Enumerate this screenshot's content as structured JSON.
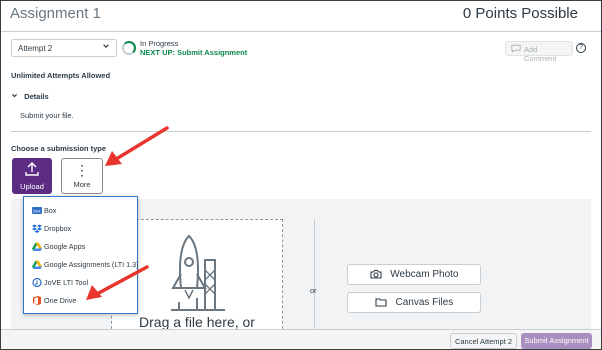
{
  "header": {
    "title": "Assignment 1",
    "points": "0 Points Possible"
  },
  "attempt": {
    "selected": "Attempt 2",
    "status": "In Progress",
    "next_up": "NEXT UP: Submit Assignment"
  },
  "comment": {
    "add_label": "Add Comment",
    "help": "?"
  },
  "info": {
    "unlimited": "Unlimited Attempts Allowed",
    "details_label": "Details",
    "details_text": "Submit your file."
  },
  "submission": {
    "choose_label": "Choose a submission type",
    "upload_label": "Upload",
    "more_label": "More",
    "menu": [
      {
        "label": "Box",
        "icon": "box-icon"
      },
      {
        "label": "Dropbox",
        "icon": "dropbox-icon"
      },
      {
        "label": "Google Apps",
        "icon": "google-drive-icon"
      },
      {
        "label": "Google Assignments (LTI 1.3)",
        "icon": "google-drive-icon"
      },
      {
        "label": "JoVE LTI Tool",
        "icon": "jove-icon"
      },
      {
        "label": "One Drive",
        "icon": "office-icon"
      }
    ],
    "drag_text": "Drag a file here, or",
    "or_text": "or",
    "webcam_label": "Webcam Photo",
    "canvas_files_label": "Canvas Files"
  },
  "footer": {
    "cancel_label": "Cancel Attempt 2",
    "submit_label": "Submit Assignment"
  },
  "colors": {
    "upload_bg": "#5b2c82",
    "submit_bg": "#a98fc0",
    "progress_green": "#0b874b",
    "arrow_red": "#e8352e",
    "dropdown_border": "#2d77c6"
  }
}
